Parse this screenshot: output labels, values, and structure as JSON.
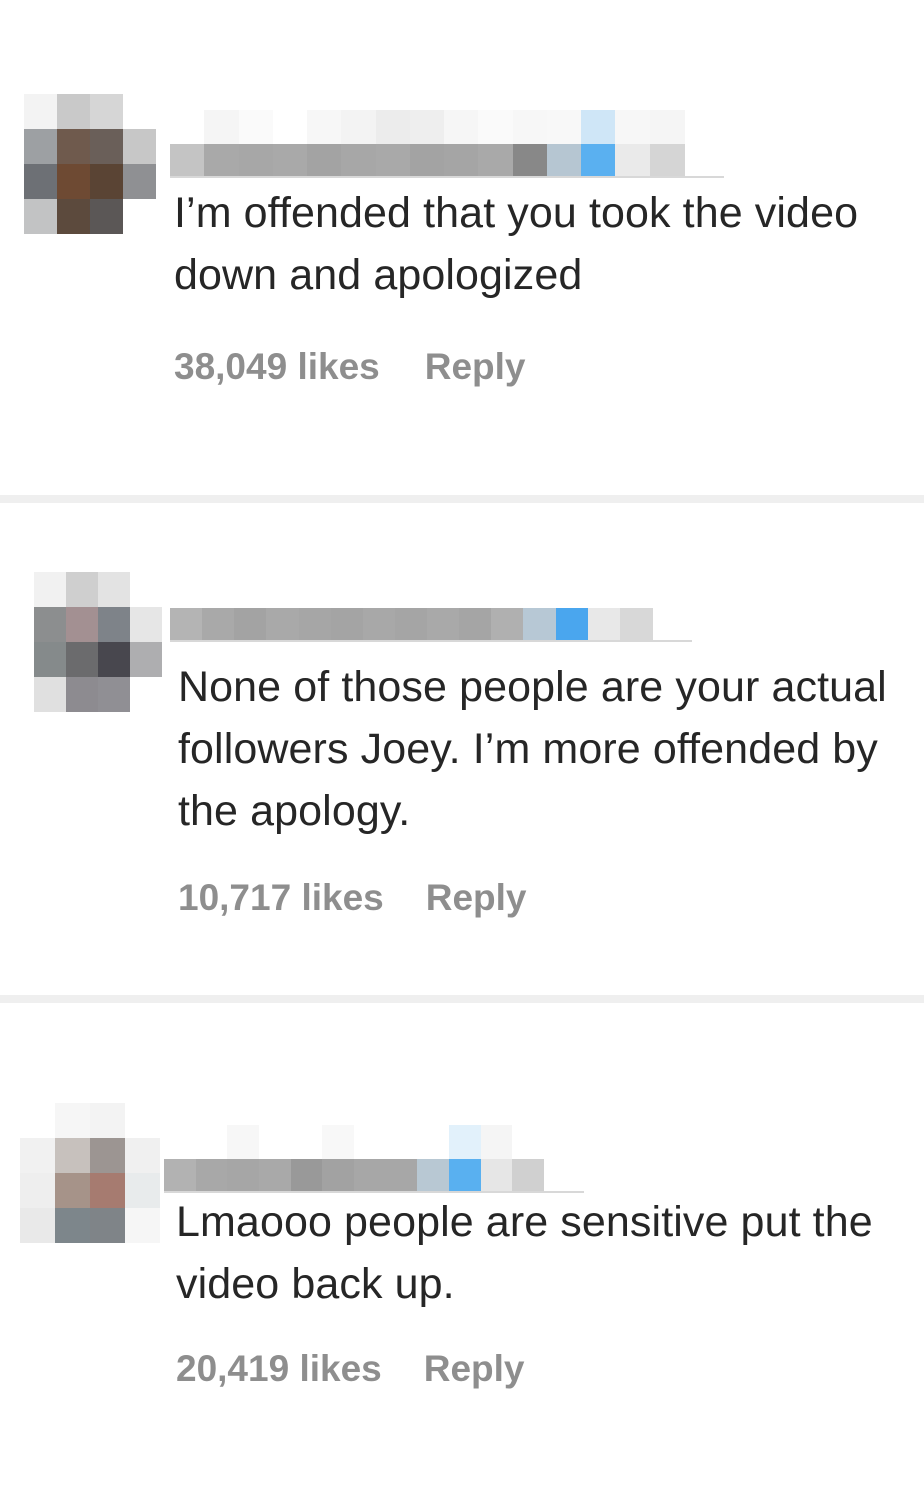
{
  "comments": [
    {
      "text": "I’m offended that you took the video down and apologized",
      "likes": "38,049 likes",
      "reply_label": "Reply",
      "avatar_colors": [
        "#f3f3f3",
        "#c9c9c9",
        "#d6d6d6",
        "#ffffff",
        "#9da0a3",
        "#6f5a4d",
        "#6a5f59",
        "#c7c7c7",
        "#6d7075",
        "#6e4a33",
        "#5a4434",
        "#8f9093",
        "#c2c3c4",
        "#5c4a3d",
        "#5b5756",
        "#ffffff"
      ],
      "username_colors": [
        "#c4c4c4",
        "#a9a9a9",
        "#a7a7a7",
        "#a9a9a9",
        "#a3a3a3",
        "#a7a7a7",
        "#a9a9a9",
        "#a3a3a3",
        "#a5a5a5",
        "#a9a9a9",
        "#888888",
        "#b6c6d2",
        "#5ab0f0",
        "#eaeaea",
        "#d5d5d5"
      ],
      "username_top_colors": [
        "#ffffff",
        "#f5f5f5",
        "#fafafa",
        "#ffffff",
        "#f7f7f7",
        "#f3f3f3",
        "#ececec",
        "#eeeeee",
        "#f6f6f6",
        "#fafafa",
        "#f7f7f7",
        "#f8f8f8",
        "#cfe6f7",
        "#f7f7f7",
        "#f5f5f5"
      ]
    },
    {
      "text": "None of those people are your actual followers Joey. I’m more offended by the apology.",
      "likes": "10,717 likes",
      "reply_label": "Reply",
      "avatar_colors": [
        "#f1f1f1",
        "#cfcfcf",
        "#e3e3e3",
        "#ffffff",
        "#8c8e8f",
        "#a39092",
        "#7e8389",
        "#e6e6e6",
        "#858a8b",
        "#6b6b6d",
        "#48474e",
        "#aeaeb0",
        "#e0e0e0",
        "#8d8b90",
        "#908f94",
        "#ffffff"
      ],
      "username_colors": [
        "#b4b4b4",
        "#a9a9a9",
        "#a3a3a3",
        "#a9a9a9",
        "#a6a6a6",
        "#a4a4a4",
        "#a8a8a8",
        "#a5a5a5",
        "#a9a9a9",
        "#a5a5a5",
        "#b0b0b0",
        "#b7c8d5",
        "#4aa6ee",
        "#e8e8e8",
        "#d8d8d8"
      ],
      "username_top_colors": [
        "#ffffff",
        "#ffffff",
        "#ffffff",
        "#ffffff",
        "#ffffff",
        "#ffffff",
        "#ffffff",
        "#ffffff",
        "#ffffff",
        "#ffffff",
        "#ffffff",
        "#ffffff",
        "#ffffff",
        "#ffffff",
        "#ffffff"
      ]
    },
    {
      "text": "Lmaooo people are sensitive put the video back up.",
      "likes": "20,419 likes",
      "reply_label": "Reply",
      "avatar_colors": [
        "#ffffff",
        "#f6f6f6",
        "#f3f3f3",
        "#ffffff",
        "#f1f1f1",
        "#c7c1bd",
        "#9c9592",
        "#f0f0f0",
        "#eeeeee",
        "#a69389",
        "#a67b70",
        "#e8ebec",
        "#e9e9e9",
        "#7d868b",
        "#7f8488",
        "#f6f6f6"
      ],
      "username_colors": [
        "#b2b2b2",
        "#a8a8a8",
        "#a6a6a6",
        "#a9a9a9",
        "#999999",
        "#a2a2a2",
        "#a7a7a7",
        "#a7a7a7",
        "#b8c8d3",
        "#59b0f0",
        "#e6e6e6",
        "#d0d0d0"
      ],
      "username_top_colors": [
        "#ffffff",
        "#ffffff",
        "#f7f7f7",
        "#ffffff",
        "#ffffff",
        "#f8f8f8",
        "#ffffff",
        "#ffffff",
        "#ffffff",
        "#e2f1fb",
        "#f5f5f5",
        "#ffffff"
      ]
    }
  ]
}
